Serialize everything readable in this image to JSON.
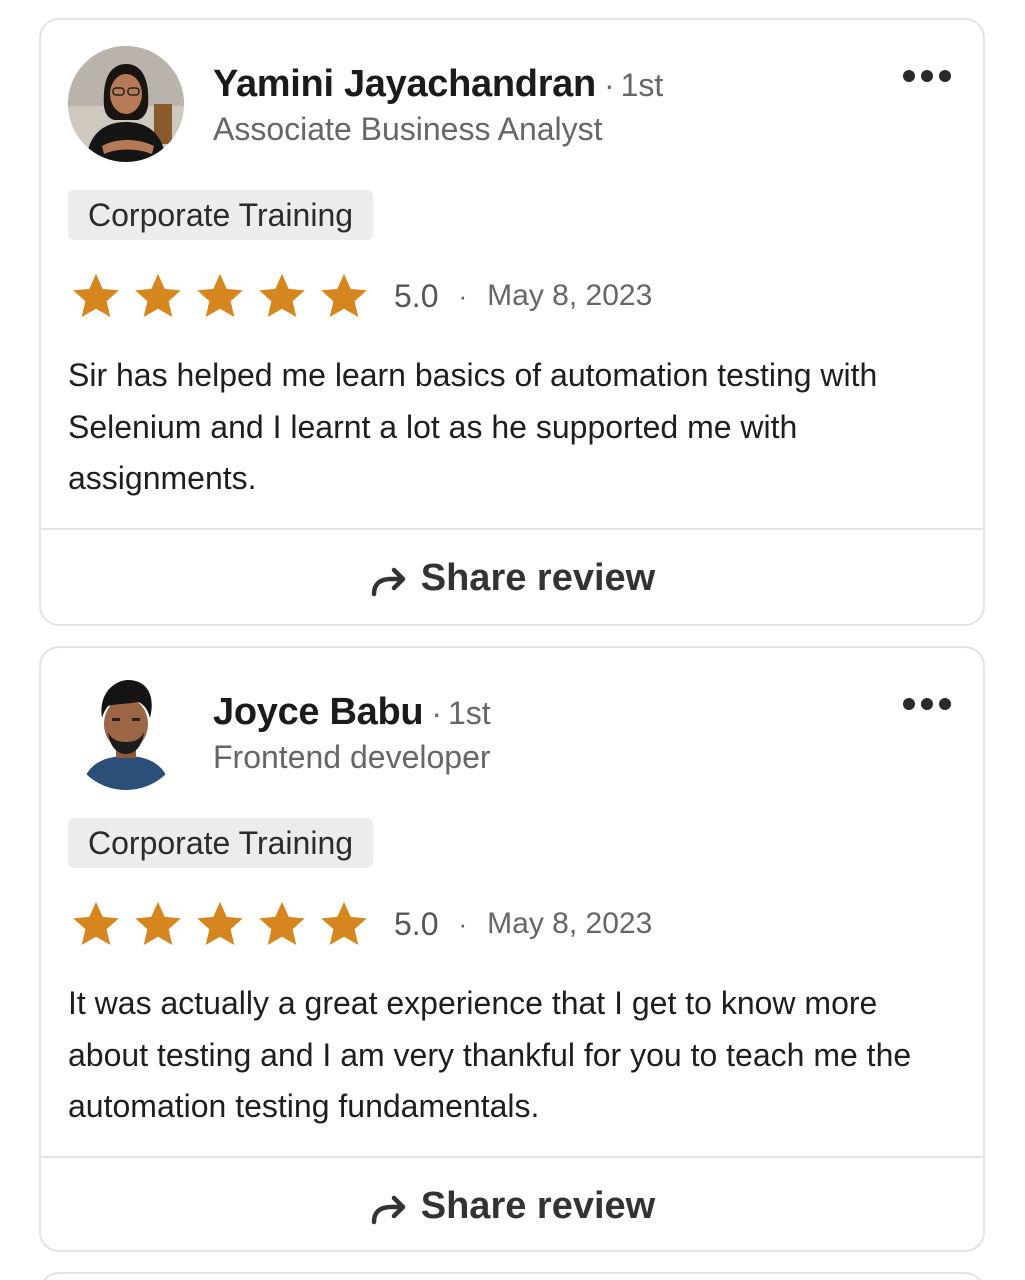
{
  "reviews": [
    {
      "name": "Yamini Jayachandran",
      "degree": "1st",
      "degree_sep": "·",
      "headline": "Associate Business Analyst",
      "tag": "Corporate Training",
      "rating_value": 5,
      "rating": "5.0",
      "date_sep": "·",
      "date": "May 8, 2023",
      "text": "Sir has helped me learn basics of automation testing with Selenium and I learnt a lot as he supported me with assignments.",
      "share_label": "Share review",
      "avatar_icon": "profile-photo"
    },
    {
      "name": "Joyce Babu",
      "degree": "1st",
      "degree_sep": "·",
      "headline": "Frontend developer",
      "tag": "Corporate Training",
      "rating_value": 5,
      "rating": "5.0",
      "date_sep": "·",
      "date": "May 8, 2023",
      "text": "It was actually a great experience that I get to know more about testing and I am very thankful for you to teach me the automation testing fundamentals.",
      "share_label": "Share review",
      "avatar_icon": "profile-photo"
    }
  ],
  "icons": {
    "more": "more-horizontal-icon",
    "star": "star-icon",
    "share": "share-arrow-icon"
  },
  "colors": {
    "star": "#d6861e",
    "chip_bg": "#ececec",
    "card_border": "#e3e3e3",
    "muted_text": "#666666"
  }
}
